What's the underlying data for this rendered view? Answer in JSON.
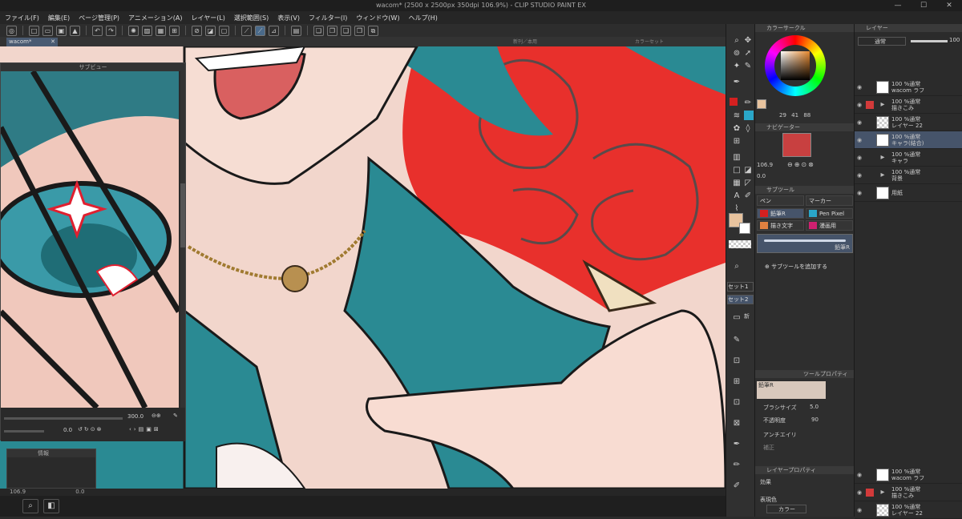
{
  "app": {
    "title": "wacom* (2500 x 2500px 350dpi 106.9%) - CLIP STUDIO PAINT EX",
    "minimize": "—",
    "maximize": "☐",
    "close": "✕"
  },
  "menu": [
    "ファイル(F)",
    "編集(E)",
    "ページ管理(P)",
    "アニメーション(A)",
    "レイヤー(L)",
    "選択範囲(S)",
    "表示(V)",
    "フィルター(I)",
    "ウィンドウ(W)",
    "ヘルプ(H)"
  ],
  "document_tab": "wacom*",
  "floating_labels": {
    "sub_view_header": "新刊／本用",
    "color_set_header": "カラーセット"
  },
  "sub_view": {
    "title": "サブビュー",
    "zoom": "300.0",
    "rotation": "0.0"
  },
  "info_panel": {
    "title": "情報"
  },
  "status": {
    "zoom": "106.9",
    "rotation": "0.0"
  },
  "color_wheel": {
    "title": "カラーサークル",
    "h": "29",
    "s": "41",
    "v": "88",
    "main_color": "#e8c39e",
    "sub_color": "#ffffff"
  },
  "navigator": {
    "title": "ナビゲーター",
    "zoom": "106.9",
    "rotation": "0.0"
  },
  "subtool": {
    "title": "サブツール",
    "groups": [
      "ペン",
      "マーカー"
    ],
    "items": [
      {
        "label": "鉛筆R",
        "color": "#d42020",
        "selected": true
      },
      {
        "label": "Pen Pixel",
        "color": "#2aa6c8",
        "selected": false
      },
      {
        "label": "描き文字",
        "color": "#e08040",
        "selected": false
      },
      {
        "label": "漫画用",
        "color": "#d02070",
        "selected": false
      }
    ],
    "preview_label": "鉛筆R",
    "add_label": "サブツールを追加する"
  },
  "tool_property": {
    "title": "ツールプロパティ",
    "tool_name": "鉛筆R",
    "brush_size_label": "ブラシサイズ",
    "brush_size": "5.0",
    "opacity_label": "不透明度",
    "opacity": "90",
    "antialias_label": "アンチエイリ",
    "stabilization_label": "補正"
  },
  "layer_property": {
    "title": "レイヤープロパティ",
    "effect_label": "効果",
    "expression_label": "表現色",
    "expression_value": "カラー"
  },
  "tool_palette": {
    "sets": [
      "セット1",
      "セット2"
    ],
    "new_label": "新"
  },
  "layers_panel": {
    "title": "レイヤー",
    "blend_mode": "通常",
    "opacity": "100",
    "layers": [
      {
        "line1": "100 %通常",
        "line2": "wacom ラフ",
        "kind": "image",
        "red": false,
        "selected": false
      },
      {
        "line1": "100 %通常",
        "line2": "描きこみ",
        "kind": "folder",
        "red": true,
        "selected": false
      },
      {
        "line1": "100 %通常",
        "line2": "レイヤー 22",
        "kind": "checker",
        "red": false,
        "selected": false
      },
      {
        "line1": "100 %通常",
        "line2": "キャラ(結合)",
        "kind": "image",
        "red": false,
        "selected": true
      },
      {
        "line1": "100 %通常",
        "line2": "キャラ",
        "kind": "folder",
        "red": false,
        "selected": false
      },
      {
        "line1": "100 %通常",
        "line2": "背景",
        "kind": "folder",
        "red": false,
        "selected": false
      },
      {
        "line1": "",
        "line2": "用紙",
        "kind": "paper",
        "red": false,
        "selected": false
      }
    ],
    "bottom_layers": [
      {
        "line1": "100 %通常",
        "line2": "wacom ラフ",
        "kind": "image",
        "red": false
      },
      {
        "line1": "100 %通常",
        "line2": "描きこみ",
        "kind": "folder",
        "red": true
      },
      {
        "line1": "100 %通常",
        "line2": "レイヤー 22",
        "kind": "checker",
        "red": false
      }
    ]
  },
  "colors": {
    "skin": "#f2d6cc",
    "teal": "#2a8a93",
    "rose_red": "#e8302c",
    "ui_bg": "#2b2b2b",
    "selection": "#46546a"
  }
}
